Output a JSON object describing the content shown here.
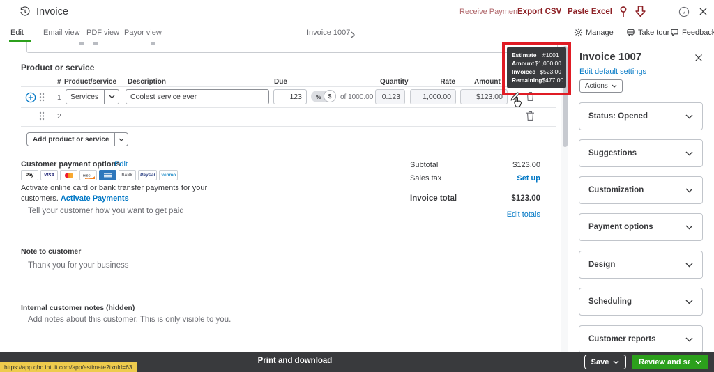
{
  "colors": {
    "accent_green": "#2ca01c",
    "link_blue": "#0077c5",
    "dark_bar": "#393a3d",
    "red_accent": "#8d2025",
    "highlight_red": "#e01b24"
  },
  "header": {
    "title": "Invoice",
    "receive_payment": "Receive Payment",
    "export_csv": "Export CSV",
    "paste_excel": "Paste Excel"
  },
  "tabbar": {
    "tabs": [
      {
        "label": "Edit"
      },
      {
        "label": "Email view"
      },
      {
        "label": "PDF view"
      },
      {
        "label": "Payor view"
      }
    ],
    "center_label": "Invoice 1007",
    "manage_label": "Manage",
    "take_tour_label": "Take tour",
    "feedback_label": "Feedback"
  },
  "product": {
    "section_title": "Product or service",
    "headers": {
      "num": "#",
      "product": "Product/service",
      "description": "Description",
      "due": "Due",
      "quantity": "Quantity",
      "rate": "Rate",
      "amount": "Amount"
    },
    "row1": {
      "num": "1",
      "product": "Services",
      "description": "Coolest service ever",
      "due": "123",
      "percent": "%",
      "dollar": "$",
      "due_of": "of 1000.00",
      "quantity": "0.123",
      "rate": "1,000.00",
      "amount": "$123.00"
    },
    "row2": {
      "num": "2"
    },
    "add_button": "Add product or service"
  },
  "tooltip": {
    "rows": [
      {
        "label": "Estimate",
        "value": "#1001"
      },
      {
        "label": "Amount",
        "value": "$1,000.00"
      },
      {
        "label": "Invoiced",
        "value": "$523.00"
      },
      {
        "label": "Remaining",
        "value": "$477.00"
      }
    ]
  },
  "payments": {
    "title": "Customer payment options",
    "edit_link": "Edit",
    "badges": {
      "applepay": "Pay",
      "visa": "VISA",
      "bank": "BANK",
      "paypal": "PayPal",
      "venmo": "venmo"
    },
    "activate_text": "Activate online card or bank transfer payments for your customers.",
    "activate_link": "Activate Payments",
    "message_placeholder": "Tell your customer how you want to get paid"
  },
  "totals": {
    "subtotal_label": "Subtotal",
    "subtotal_value": "$123.00",
    "sales_tax_label": "Sales tax",
    "sales_tax_link": "Set up",
    "total_label": "Invoice total",
    "total_value": "$123.00",
    "edit_totals_link": "Edit totals"
  },
  "notes": {
    "note_label": "Note to customer",
    "note_value": "Thank you for your business",
    "internal_label": "Internal customer notes (hidden)",
    "internal_placeholder": "Add notes about this customer. This is only visible to you."
  },
  "sidebar": {
    "title": "Invoice 1007",
    "edit_defaults": "Edit default settings",
    "actions_label": "Actions",
    "panels": [
      "Status: Opened",
      "Suggestions",
      "Customization",
      "Payment options",
      "Design",
      "Scheduling",
      "Customer reports"
    ]
  },
  "footer": {
    "print_label": "Print and download",
    "save_label": "Save",
    "review_label": "Review and send"
  },
  "statusbar": {
    "url": "https://app.qbo.intuit.com/app/estimate?txnId=63"
  }
}
